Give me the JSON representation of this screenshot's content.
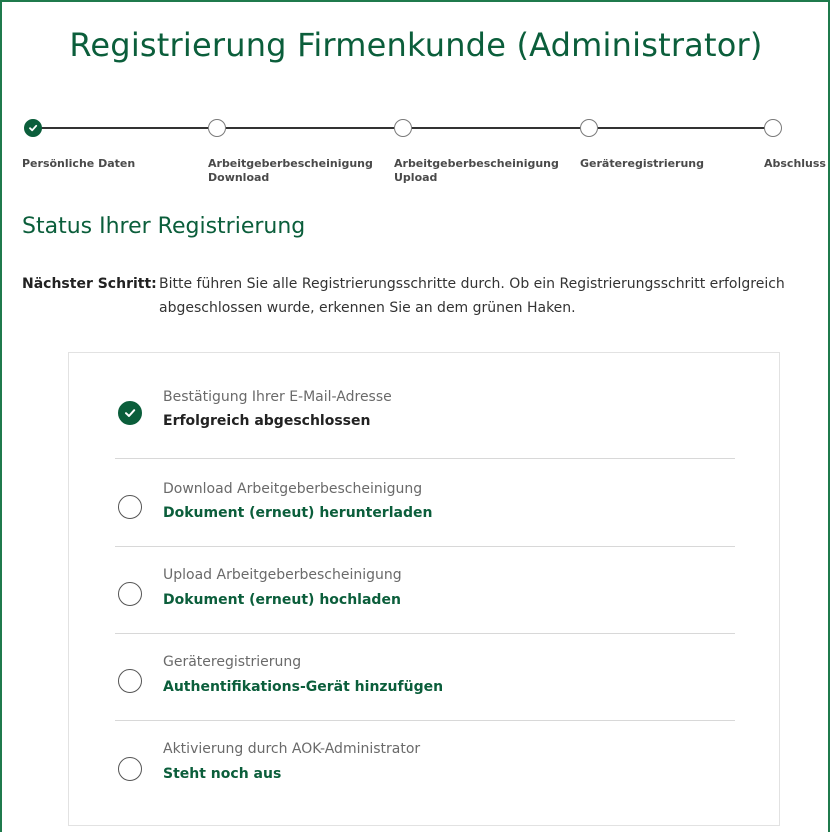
{
  "page": {
    "title": "Registrierung Firmenkunde (Administrator)"
  },
  "stepper": {
    "steps": [
      {
        "label": "Persönliche Daten",
        "done": true
      },
      {
        "label": "Arbeitgeberbescheinigung\nDownload",
        "done": false
      },
      {
        "label": "Arbeitgeberbescheinigung\nUpload",
        "done": false
      },
      {
        "label": "Geräteregistrierung",
        "done": false
      },
      {
        "label": "Abschluss",
        "done": false
      }
    ]
  },
  "status": {
    "heading": "Status Ihrer Registrierung",
    "next_step_label": "Nächster Schritt:",
    "next_step_text": "Bitte führen Sie alle Registrierungsschritte durch. Ob ein Registrierungsschritt erfolgreich abgeschlossen wurde, erkennen Sie an dem grünen Haken."
  },
  "tasks": [
    {
      "title": "Bestätigung Ihrer E-Mail-Adresse",
      "subtitle": "Erfolgreich abgeschlossen",
      "done": true
    },
    {
      "title": "Download Arbeitgeberbescheinigung",
      "subtitle": "Dokument (erneut) herunterladen",
      "done": false
    },
    {
      "title": "Upload Arbeitgeberbescheinigung",
      "subtitle": "Dokument (erneut) hochladen",
      "done": false
    },
    {
      "title": "Geräteregistrierung",
      "subtitle": "Authentifikations-Gerät hinzufügen",
      "done": false
    },
    {
      "title": "Aktivierung durch AOK-Administrator",
      "subtitle": "Steht noch aus",
      "done": false
    }
  ],
  "colors": {
    "brand_green": "#0b5e3b",
    "frame_green": "#1f7a4c"
  }
}
